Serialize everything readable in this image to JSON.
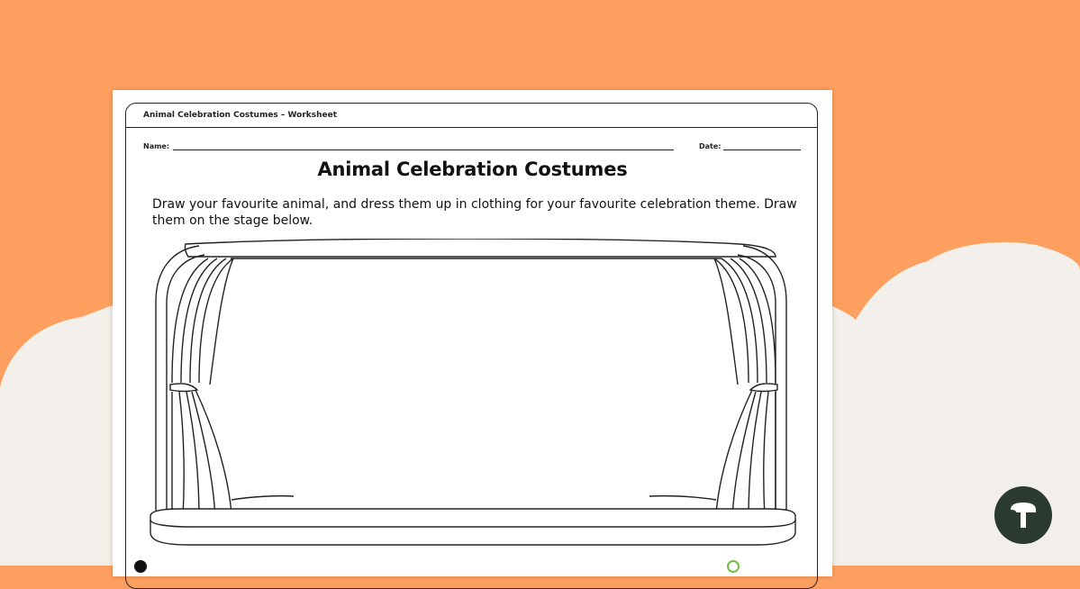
{
  "worksheet": {
    "header_title": "Animal Celebration Costumes – Worksheet",
    "name_label": "Name:",
    "date_label": "Date:",
    "title": "Animal Celebration Costumes",
    "instructions": "Draw your favourite animal, and dress them up in clothing for your favourite celebration theme. Draw them on the stage below."
  },
  "colors": {
    "background": "#fda05f",
    "cloud": "#f3efea",
    "sheet": "#ffffff",
    "logo": "#2c3b2f"
  },
  "icons": {
    "brand_logo": "teach-starter-logo-icon",
    "stage": "stage-curtains-illustration"
  }
}
